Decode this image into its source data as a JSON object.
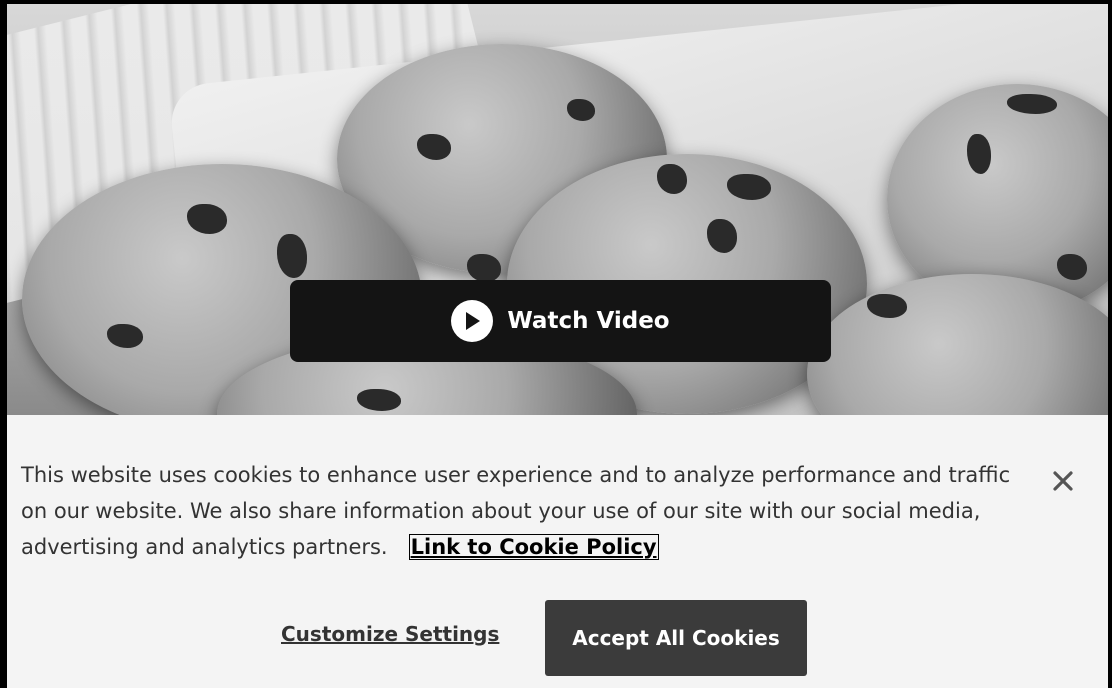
{
  "hero": {
    "image_subject": "chocolate-chip-cookies-photo",
    "video_button_label": "Watch Video",
    "play_icon": "play-circle-icon"
  },
  "cookie_banner": {
    "message": "This website uses cookies to enhance user experience and to analyze performance and traffic on our website. We also share information about your use of our site with our social media, advertising and analytics partners.",
    "policy_link_label": "Link to Cookie Policy",
    "close_icon": "close-icon",
    "customize_label": "Customize Settings",
    "accept_label": "Accept All Cookies"
  },
  "colors": {
    "banner_bg": "#f4f4f4",
    "video_button_bg": "#141414",
    "accept_button_bg": "#3b3b3b",
    "text": "#333333"
  }
}
